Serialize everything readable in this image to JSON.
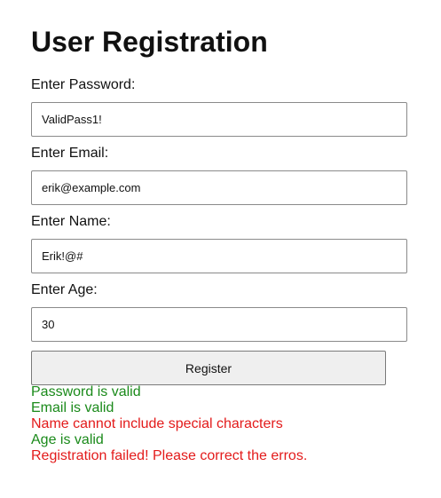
{
  "page": {
    "title": "User Registration"
  },
  "form": {
    "password": {
      "label": "Enter Password:",
      "value": "ValidPass1!"
    },
    "email": {
      "label": "Enter Email:",
      "value": "erik@example.com"
    },
    "name": {
      "label": "Enter Name:",
      "value": "Erik!@#"
    },
    "age": {
      "label": "Enter Age:",
      "value": "30"
    },
    "register_label": "Register"
  },
  "messages": {
    "password": "Password is valid",
    "email": "Email is valid",
    "name": "Name cannot include special characters",
    "age": "Age is valid",
    "result": "Registration failed! Please correct the erros."
  },
  "colors": {
    "valid": "#1a8a1a",
    "error": "#e31b1b",
    "button_bg": "#efefef"
  }
}
